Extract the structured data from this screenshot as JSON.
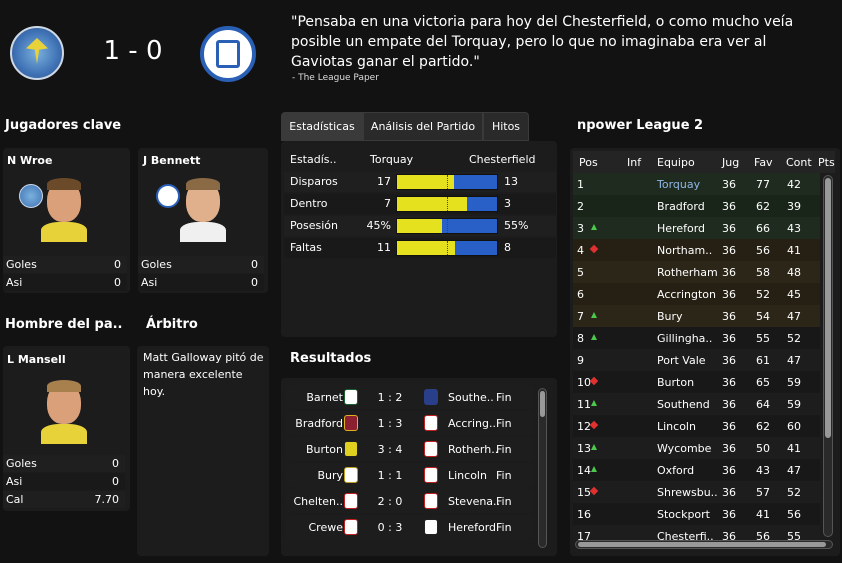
{
  "match": {
    "score": "1 - 0",
    "home": "Torquay",
    "away": "Chesterfield"
  },
  "quote": {
    "text": "\"Pensaba en una victoria para hoy del Chesterfield, o como mucho veía posible un empate del Torquay, pero lo que no imaginaba era ver al Gaviotas ganar el partido.\"",
    "source": "- The League Paper"
  },
  "key_players": {
    "title": "Jugadores clave",
    "players": [
      {
        "name": "N Wroe",
        "stats": [
          {
            "label": "Goles",
            "value": "0"
          },
          {
            "label": "Asi",
            "value": "0"
          }
        ]
      },
      {
        "name": "J Bennett",
        "stats": [
          {
            "label": "Goles",
            "value": "0"
          },
          {
            "label": "Asi",
            "value": "0"
          }
        ]
      }
    ]
  },
  "motm": {
    "title": "Hombre del pa..",
    "name": "L Mansell",
    "stats": [
      {
        "label": "Goles",
        "value": "0"
      },
      {
        "label": "Asi",
        "value": "0"
      },
      {
        "label": "Cal",
        "value": "7.70"
      }
    ]
  },
  "referee": {
    "title": "Árbitro",
    "text": "Matt Galloway pitó de manera excelente hoy."
  },
  "stats": {
    "tabs": [
      "Estadísticas",
      "Análisis del Partido",
      "Hitos"
    ],
    "header": {
      "label": "Estadís..",
      "home": "Torquay",
      "away": "Chesterfield"
    },
    "rows": [
      {
        "label": "Disparos",
        "home": "17",
        "away": "13",
        "home_frac": 0.567
      },
      {
        "label": "Dentro",
        "home": "7",
        "away": "3",
        "home_frac": 0.7
      },
      {
        "label": "Posesión",
        "home": "45%",
        "away": "55%",
        "home_frac": 0.45
      },
      {
        "label": "Faltas",
        "home": "11",
        "away": "8",
        "home_frac": 0.579
      }
    ]
  },
  "results": {
    "title": "Resultados",
    "rows": [
      {
        "home": "Barnet",
        "score": "1 : 2",
        "away": "Southe..",
        "status": "Fin"
      },
      {
        "home": "Bradford",
        "score": "1 : 3",
        "away": "Accring..",
        "status": "Fin"
      },
      {
        "home": "Burton",
        "score": "3 : 4",
        "away": "Rotherh..",
        "status": "Fin"
      },
      {
        "home": "Bury",
        "score": "1 : 1",
        "away": "Lincoln",
        "status": "Fin"
      },
      {
        "home": "Chelten..",
        "score": "2 : 0",
        "away": "Stevena..",
        "status": "Fin"
      },
      {
        "home": "Crewe",
        "score": "0 : 3",
        "away": "Hereford",
        "status": "Fin"
      }
    ]
  },
  "league": {
    "title": "npower League 2",
    "columns": [
      "Pos",
      "Inf",
      "Equipo",
      "Jug",
      "Fav",
      "Cont",
      "Pts"
    ],
    "rows": [
      {
        "pos": "1",
        "move": "",
        "team": "Torquay",
        "jug": "36",
        "fav": "77",
        "cont": "42",
        "zone": "promo"
      },
      {
        "pos": "2",
        "move": "",
        "team": "Bradford",
        "jug": "36",
        "fav": "62",
        "cont": "39",
        "zone": "promo"
      },
      {
        "pos": "3",
        "move": "up",
        "team": "Hereford",
        "jug": "36",
        "fav": "66",
        "cont": "43",
        "zone": "promo"
      },
      {
        "pos": "4",
        "move": "down",
        "team": "Northam..",
        "jug": "36",
        "fav": "56",
        "cont": "41",
        "zone": "playoff"
      },
      {
        "pos": "5",
        "move": "",
        "team": "Rotherham",
        "jug": "36",
        "fav": "58",
        "cont": "48",
        "zone": "playoff"
      },
      {
        "pos": "6",
        "move": "",
        "team": "Accrington",
        "jug": "36",
        "fav": "52",
        "cont": "45",
        "zone": "playoff"
      },
      {
        "pos": "7",
        "move": "up",
        "team": "Bury",
        "jug": "36",
        "fav": "54",
        "cont": "47",
        "zone": "playoff"
      },
      {
        "pos": "8",
        "move": "up",
        "team": "Gillingha..",
        "jug": "36",
        "fav": "55",
        "cont": "52",
        "zone": ""
      },
      {
        "pos": "9",
        "move": "",
        "team": "Port Vale",
        "jug": "36",
        "fav": "61",
        "cont": "47",
        "zone": ""
      },
      {
        "pos": "10",
        "move": "down",
        "team": "Burton",
        "jug": "36",
        "fav": "65",
        "cont": "59",
        "zone": ""
      },
      {
        "pos": "11",
        "move": "up",
        "team": "Southend",
        "jug": "36",
        "fav": "64",
        "cont": "59",
        "zone": ""
      },
      {
        "pos": "12",
        "move": "down",
        "team": "Lincoln",
        "jug": "36",
        "fav": "62",
        "cont": "60",
        "zone": ""
      },
      {
        "pos": "13",
        "move": "up",
        "team": "Wycombe",
        "jug": "36",
        "fav": "50",
        "cont": "41",
        "zone": ""
      },
      {
        "pos": "14",
        "move": "up",
        "team": "Oxford",
        "jug": "36",
        "fav": "43",
        "cont": "47",
        "zone": ""
      },
      {
        "pos": "15",
        "move": "down",
        "team": "Shrewsbu..",
        "jug": "36",
        "fav": "57",
        "cont": "52",
        "zone": ""
      },
      {
        "pos": "16",
        "move": "",
        "team": "Stockport",
        "jug": "36",
        "fav": "41",
        "cont": "56",
        "zone": ""
      },
      {
        "pos": "17",
        "move": "",
        "team": "Chesterfi..",
        "jug": "36",
        "fav": "56",
        "cont": "55",
        "zone": ""
      }
    ]
  },
  "colors": {
    "home_bar": "#e6e11e",
    "away_bar": "#2860c8",
    "promo_row": "#1f2b1f",
    "playoff_row": "#2c2618",
    "torquay_text": "#8fb6e6"
  }
}
